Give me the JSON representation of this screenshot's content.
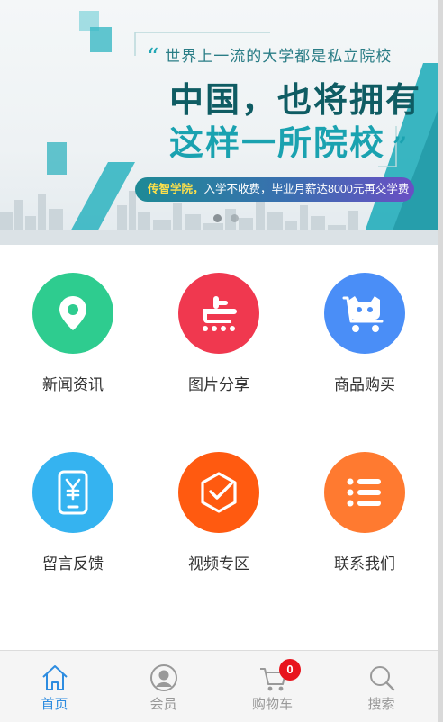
{
  "banner": {
    "quote_line": "世界上一流的大学都是私立院校",
    "headline_1": "中国，也将拥有",
    "headline_2": "这样一所院校",
    "pill_name": "传智学院，",
    "pill_text": "入学不收费，毕业月薪达8000元再交学费",
    "slides_count": 2,
    "active_slide": 1
  },
  "menu": {
    "items": [
      {
        "label": "新闻资讯",
        "icon": "location-pin-icon",
        "color": "#2ecc8f"
      },
      {
        "label": "图片分享",
        "icon": "dian-logo-icon",
        "color": "#f0384f"
      },
      {
        "label": "商品购买",
        "icon": "cat-cart-icon",
        "color": "#4a8ef7"
      },
      {
        "label": "留言反馈",
        "icon": "phone-yuan-icon",
        "color": "#35b3f0"
      },
      {
        "label": "视频专区",
        "icon": "hexagon-check-icon",
        "color": "#ff5a10"
      },
      {
        "label": "联系我们",
        "icon": "list-icon",
        "color": "#ff7a30"
      }
    ]
  },
  "tabbar": {
    "tabs": [
      {
        "label": "首页",
        "icon": "home-icon",
        "active": true
      },
      {
        "label": "会员",
        "icon": "member-icon",
        "active": false
      },
      {
        "label": "购物车",
        "icon": "cart-icon",
        "active": false,
        "badge": "0"
      },
      {
        "label": "搜索",
        "icon": "search-icon",
        "active": false
      }
    ],
    "active_color": "#2d8ce0",
    "inactive_color": "#999999",
    "badge_color": "#e8141d"
  }
}
